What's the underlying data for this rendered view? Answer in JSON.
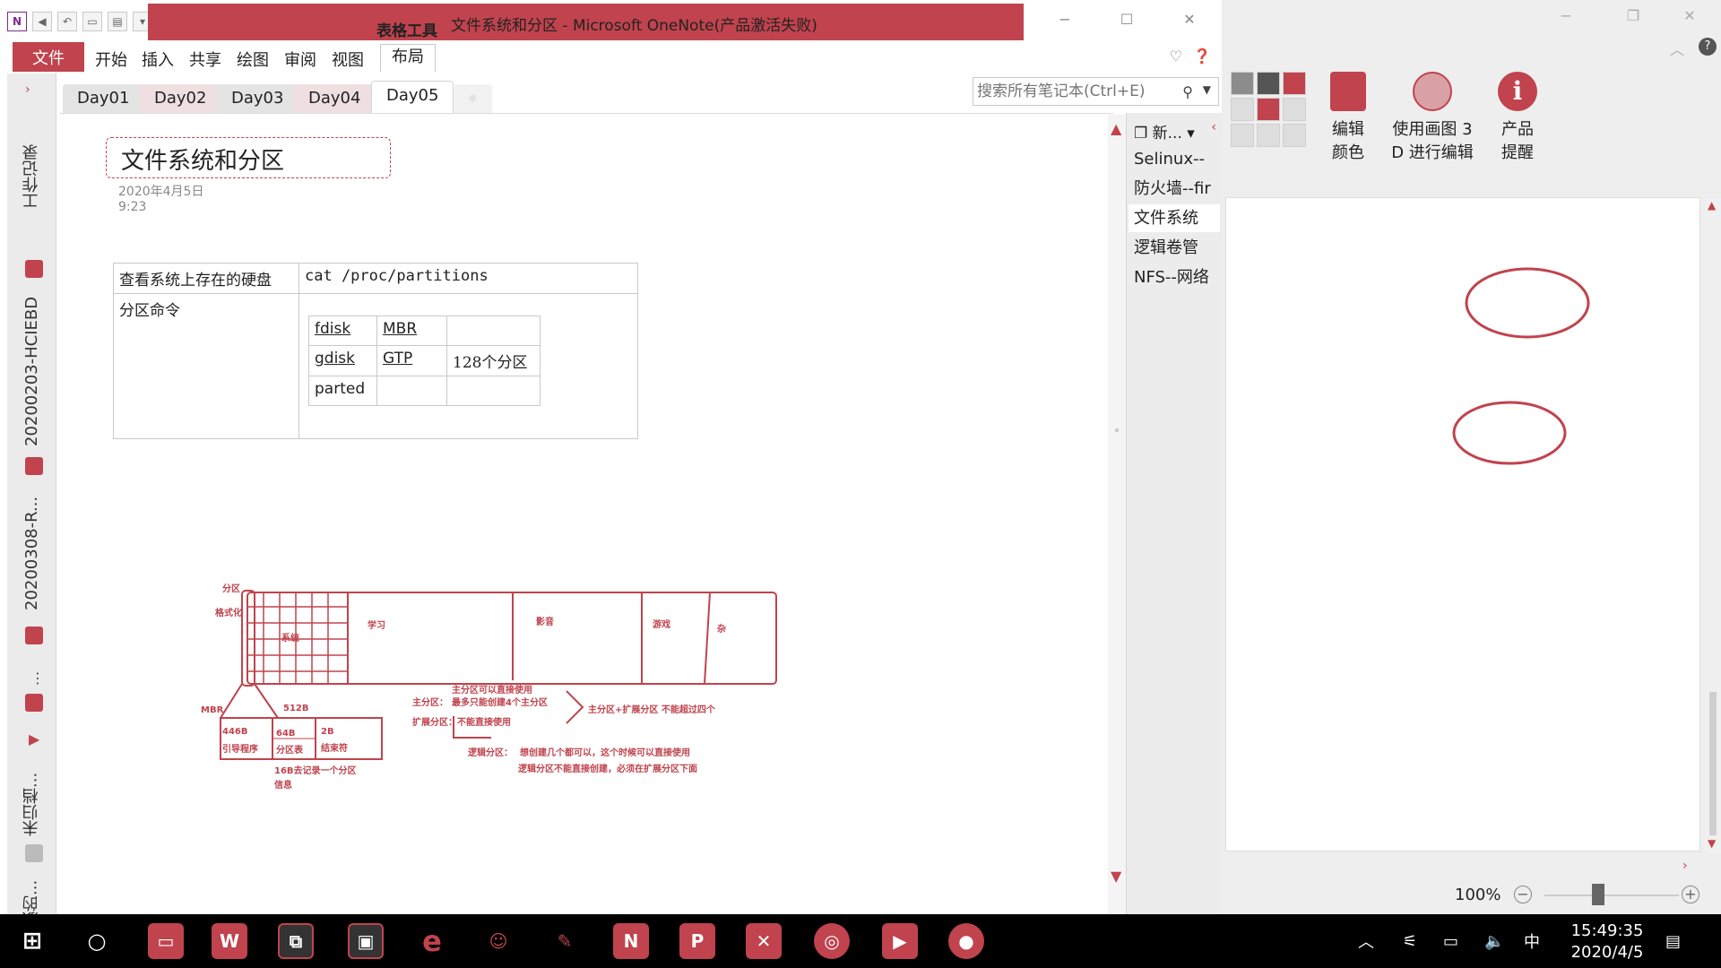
{
  "window": {
    "context_tab": "表格工具",
    "title": "文件系统和分区 - Microsoft OneNote(产品激活失败)",
    "minimize": "−",
    "maximize": "☐",
    "close": "✕"
  },
  "ribbon": {
    "file": "文件",
    "tabs": [
      "开始",
      "插入",
      "共享",
      "绘图",
      "审阅",
      "视图"
    ],
    "active_tab": "布局"
  },
  "notebooks": [
    "工作记录",
    "20200203-HCIEBD",
    "20200308-R...",
    "未归档...",
    "错放的..."
  ],
  "sections": [
    "Day01",
    "Day02",
    "Day03",
    "Day04",
    "Day05"
  ],
  "search": {
    "placeholder": "搜索所有笔记本(Ctrl+E)"
  },
  "page": {
    "title": "文件系统和分区",
    "date": "2020年4月5日",
    "time": "9:23",
    "table": {
      "row1_label": "查看系统上存在的硬盘",
      "row1_value": "cat /proc/partitions",
      "row2_label": "分区命令",
      "inner": [
        [
          "fdisk",
          "MBR",
          ""
        ],
        [
          "gdisk",
          "GTP",
          "128个分区"
        ],
        [
          "parted",
          "",
          ""
        ]
      ]
    },
    "sketch": {
      "partition": "分区",
      "format": "格式化",
      "system": "系统",
      "study": "学习",
      "video": "影音",
      "game": "游戏",
      "misc": "杂",
      "mbr": "MBR",
      "b512": "512B",
      "b446": "446B",
      "boot": "引导程序",
      "b64": "64B",
      "ptable": "分区表",
      "b2": "2B",
      "end": "结束符",
      "b16": "16B去记录一个分区",
      "info": "信息",
      "primary_note1": "主分区可以直接使用",
      "primary_label": "主分区：",
      "primary_note2": "最多只能创建4个主分区",
      "extended": "扩展分区：不能直接使用",
      "sum_note": "主分区+扩展分区 不能超过四个",
      "logical_label": "逻辑分区：",
      "logical1": "想创建几个都可以，这个时候可以直接使用",
      "logical2": "逻辑分区不能直接创建，必须在扩展分区下面"
    }
  },
  "page_list": {
    "new_page": "新...",
    "items": [
      "Selinux--",
      "防火墙--fir",
      "文件系统",
      "逻辑卷管",
      "NFS--网络"
    ],
    "active_index": 2
  },
  "paint": {
    "edit_color": [
      "编辑",
      "颜色"
    ],
    "paint3d": [
      "使用画图 3",
      "D 进行编辑"
    ],
    "product": [
      "产品",
      "提醒"
    ],
    "zoom": "100%",
    "zoom_minus": "−",
    "zoom_plus": "+"
  },
  "taskbar": {
    "ime": "中",
    "time": "15:49:35",
    "date": "2020/4/5"
  },
  "colors": {
    "accent": "#c0434d",
    "ink": "#c0434d"
  }
}
